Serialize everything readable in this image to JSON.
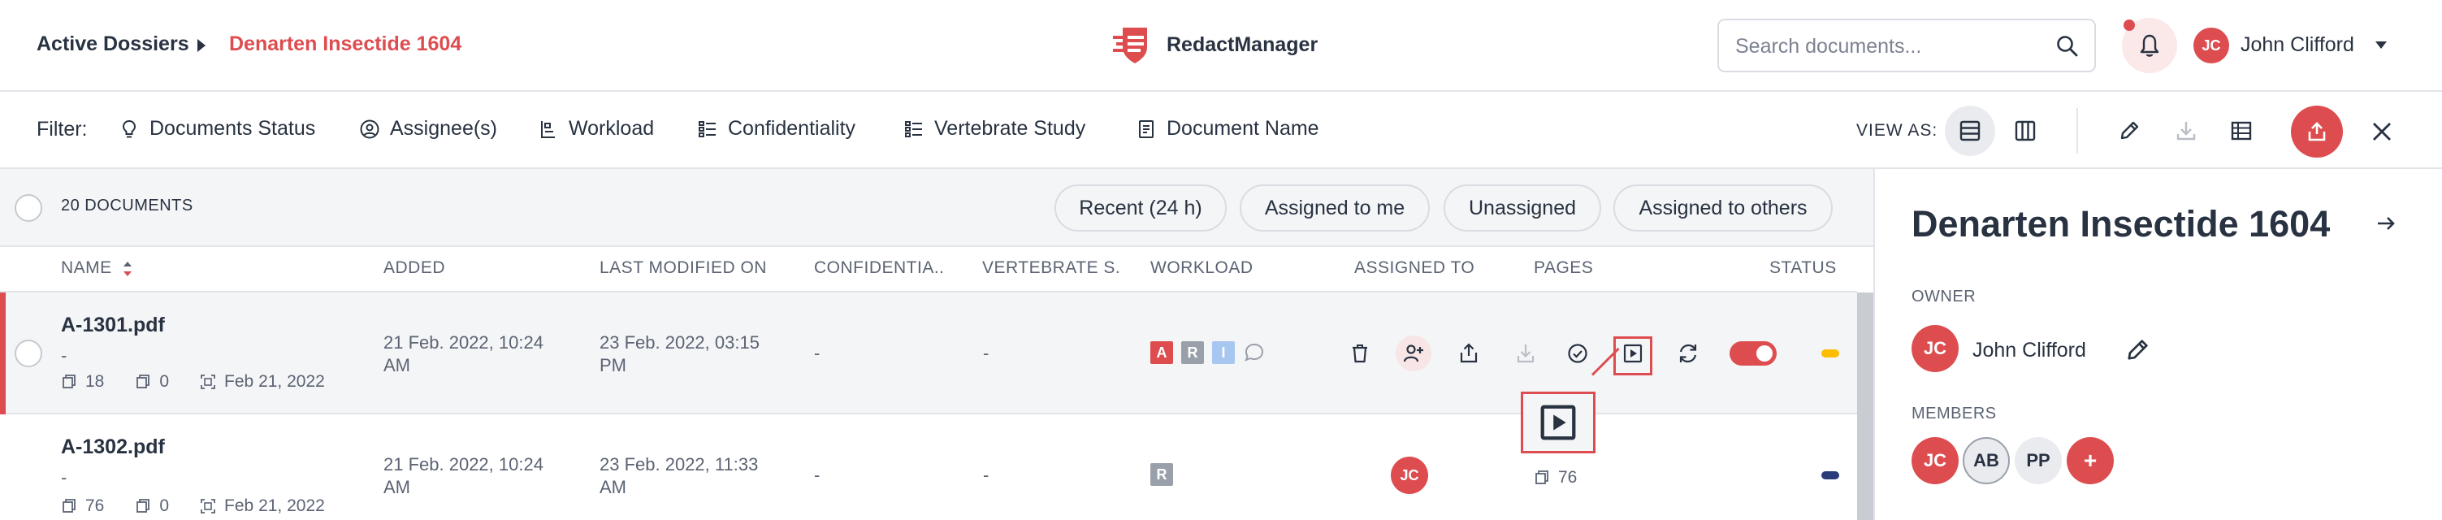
{
  "header": {
    "breadcrumb_root": "Active Dossiers",
    "breadcrumb_current": "Denarten Insectide 1604",
    "brand": "RedactManager",
    "search_placeholder": "Search documents...",
    "user_initials": "JC",
    "user_name": "John Clifford"
  },
  "filters": {
    "label": "Filter:",
    "items": [
      "Documents Status",
      "Assignee(s)",
      "Workload",
      "Confidentiality",
      "Vertebrate Study",
      "Document Name"
    ],
    "view_as_label": "VIEW AS:"
  },
  "list": {
    "doc_count": "20 DOCUMENTS",
    "quick_filters": [
      "Recent (24 h)",
      "Assigned to me",
      "Unassigned",
      "Assigned to others"
    ],
    "columns": [
      "NAME",
      "ADDED",
      "LAST MODIFIED ON",
      "CONFIDENTIA...",
      "VERTEBRATE S...",
      "WORKLOAD",
      "ASSIGNED TO",
      "PAGES",
      "STATUS"
    ],
    "rows": [
      {
        "name": "A-1301.pdf",
        "subtitle": "-",
        "pages": "18",
        "excluded": "0",
        "date": "Feb 21, 2022",
        "added": "21 Feb. 2022, 10:24 AM",
        "modified": "23 Feb. 2022, 03:15 PM",
        "confidentiality": "-",
        "vertebrate": "-",
        "workload": [
          "A",
          "R",
          "I"
        ],
        "status_color": "#fdbd00"
      },
      {
        "name": "A-1302.pdf",
        "subtitle": "-",
        "pages": "76",
        "excluded": "0",
        "date": "Feb 21, 2022",
        "added": "21 Feb. 2022, 10:24 AM",
        "modified": "23 Feb. 2022, 11:33 AM",
        "confidentiality": "-",
        "vertebrate": "-",
        "workload": [
          "R"
        ],
        "assignee": "JC",
        "page_count": "76",
        "status_color": "#283c7a"
      }
    ]
  },
  "panel": {
    "title": "Denarten Insectide 1604",
    "owner_label": "OWNER",
    "owner_initials": "JC",
    "owner_name": "John Clifford",
    "members_label": "MEMBERS",
    "members": [
      "JC",
      "AB",
      "PP"
    ],
    "add_member": "+"
  },
  "colors": {
    "accent": "#dd4d50",
    "text": "#283241",
    "muted": "#5b6373",
    "rule": "#e2e4e9"
  }
}
